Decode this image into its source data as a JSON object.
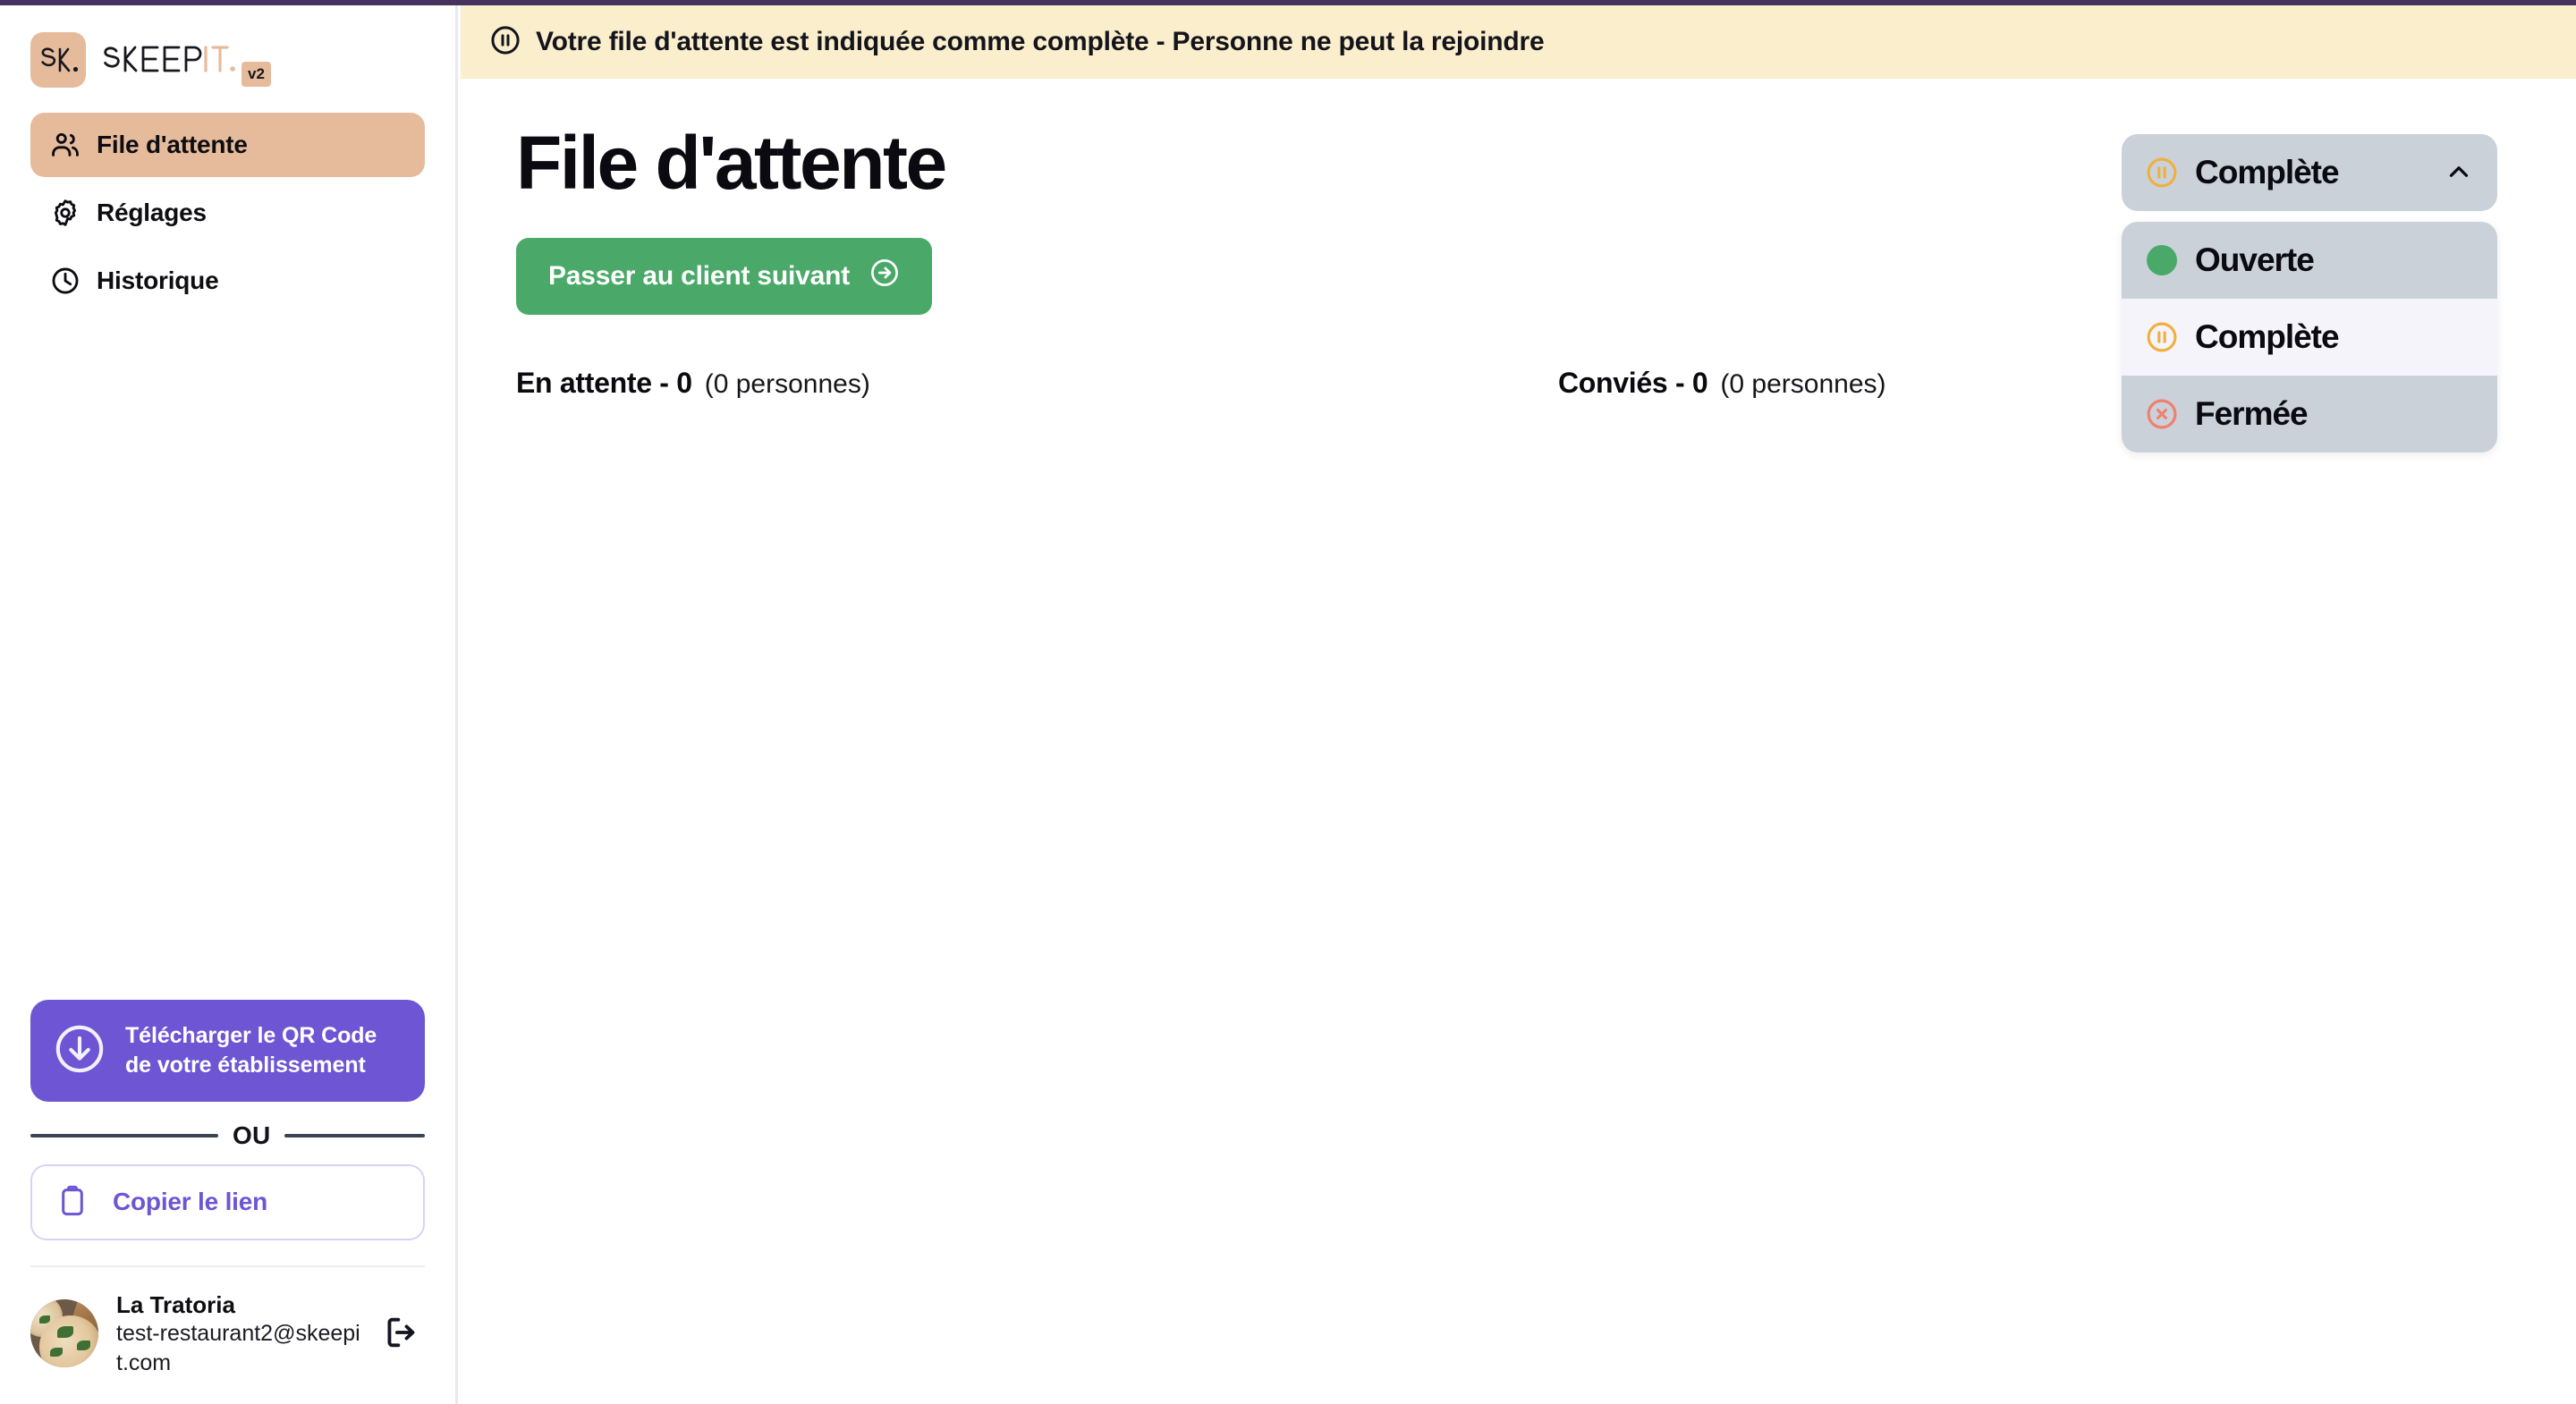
{
  "brand": {
    "mark_text": "SK.",
    "wordmark_dark": "SKEEP",
    "wordmark_accent": "IT.",
    "version_badge": "v2",
    "accent_color": "#e6bb9c"
  },
  "banner": {
    "icon": "pause-circle-icon",
    "message": "Votre file d'attente est indiquée comme complète - Personne ne peut la rejoindre",
    "background_color": "#faeecc"
  },
  "sidebar": {
    "items": [
      {
        "label": "File d'attente",
        "icon": "users-icon",
        "active": true
      },
      {
        "label": "Réglages",
        "icon": "gear-icon",
        "active": false
      },
      {
        "label": "Historique",
        "icon": "clock-icon",
        "active": false
      }
    ],
    "qr_button": {
      "icon": "download-circle-icon",
      "line1": "Télécharger le QR Code",
      "line2": "de votre établissement",
      "background_color": "#6d55d4"
    },
    "divider_text": "OU",
    "copy_button": {
      "icon": "clipboard-icon",
      "label": "Copier le lien",
      "accent_color": "#6d55d4"
    },
    "account": {
      "avatar": "restaurant-photo-avatar",
      "name": "La Tratoria",
      "email": "test-restaurant2@skeepit.com",
      "logout_icon": "logout-icon"
    }
  },
  "main": {
    "title": "File d'attente",
    "next_button": {
      "label": "Passer au client suivant",
      "icon": "arrow-right-circle-icon",
      "background_color": "#4aa968"
    },
    "counters": [
      {
        "main": "En attente - 0",
        "sub": "(0 personnes)"
      },
      {
        "main": "Conviés - 0",
        "sub": "(0 personnes)"
      }
    ]
  },
  "status_dropdown": {
    "selected_label": "Complète",
    "selected_icon": "pause-circle-icon",
    "chevron_icon": "chevron-up-icon",
    "expanded": true,
    "options": [
      {
        "label": "Ouverte",
        "icon": "green-dot-icon",
        "color": "#4aa968",
        "selected": false
      },
      {
        "label": "Complète",
        "icon": "pause-circle-icon",
        "color": "#efb03f",
        "selected": true
      },
      {
        "label": "Fermée",
        "icon": "x-circle-icon",
        "color": "#ef7f6e",
        "selected": false
      }
    ]
  }
}
